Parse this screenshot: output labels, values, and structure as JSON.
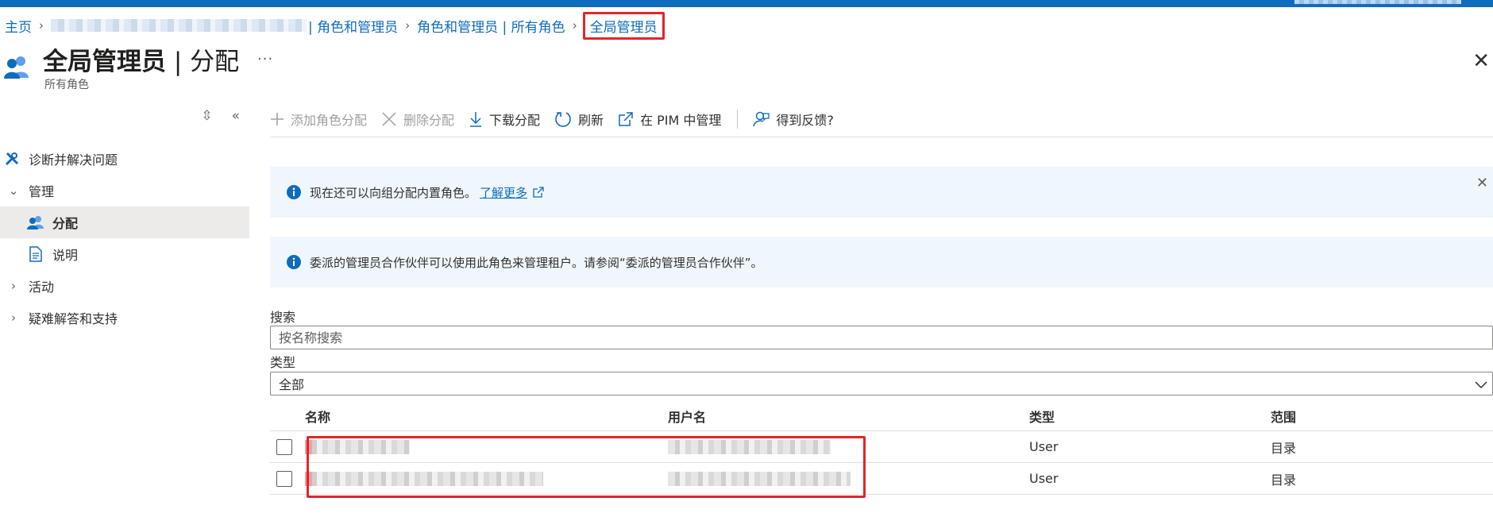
{
  "breadcrumb": {
    "home": "主页",
    "parent": "| 角色和管理员",
    "roles": "角色和管理员 | 所有角色",
    "current": "全局管理员"
  },
  "header": {
    "title_main": "全局管理员",
    "title_sep": " | ",
    "title_section": "分配",
    "subtitle": "所有角色",
    "more": "···",
    "close": "✕"
  },
  "sidebar": {
    "items": [
      {
        "label": "诊断并解决问题"
      },
      {
        "label": "管理"
      },
      {
        "label": "分配"
      },
      {
        "label": "说明"
      },
      {
        "label": "活动"
      },
      {
        "label": "疑难解答和支持"
      }
    ]
  },
  "toolbar": {
    "add": "添加角色分配",
    "remove": "删除分配",
    "download": "下载分配",
    "refresh": "刷新",
    "pim": "在 PIM 中管理",
    "feedback": "得到反馈?"
  },
  "banners": {
    "groups_text": "现在还可以向组分配内置角色。",
    "groups_link": "了解更多",
    "partner_text": "委派的管理员合作伙伴可以使用此角色来管理租户。请参阅“委派的管理员合作伙伴”。"
  },
  "search": {
    "label": "搜索",
    "placeholder": "按名称搜索"
  },
  "type_filter": {
    "label": "类型",
    "value": "全部"
  },
  "table": {
    "columns": [
      "名称",
      "用户名",
      "类型",
      "范围"
    ],
    "rows": [
      {
        "type": "User",
        "scope": "目录"
      },
      {
        "type": "User",
        "scope": "目录"
      }
    ]
  },
  "colors": {
    "accent": "#0f6cbd",
    "highlight": "#e0262a",
    "info_bg": "#eff6fc"
  }
}
